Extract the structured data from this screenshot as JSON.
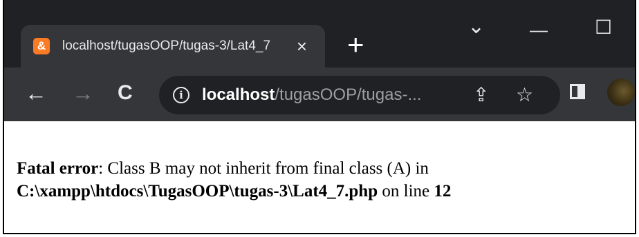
{
  "tab": {
    "favicon_glyph": "&",
    "favicon_color": "#fb7a24",
    "title": "localhost/tugasOOP/tugas-3/Lat4_7.php",
    "close_glyph": "×"
  },
  "tabstrip": {
    "new_tab_glyph": "+",
    "tab_search_glyph": "⌄",
    "minimize_glyph": "—",
    "maximize_glyph": "☐"
  },
  "toolbar": {
    "back_glyph": "←",
    "forward_glyph": "→",
    "reload_glyph": "C",
    "info_glyph": "i",
    "url_host": "localhost",
    "url_path": "/tugasOOP/tugas-...",
    "share_glyph": "⇪",
    "bookmark_glyph": "☆"
  },
  "page": {
    "error_label": "Fatal error",
    "error_message": ": Class B may not inherit from final class (A) in",
    "error_file": "C:\\xampp\\htdocs\\TugasOOP\\tugas-3\\Lat4_7.php",
    "error_online": " on line ",
    "error_line": "12"
  }
}
